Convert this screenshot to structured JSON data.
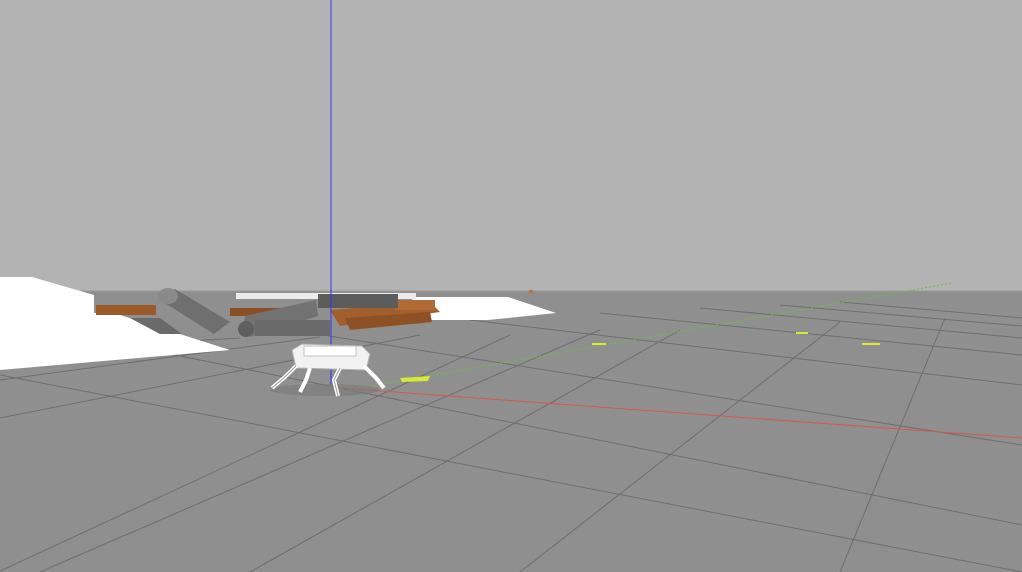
{
  "viewport": {
    "type": "3d-simulation-view",
    "sky_color": "#b3b3b3",
    "ground_color": "#8f8f8f",
    "grid_color": "#6e6e6e"
  },
  "axes": {
    "z_color": "#3030ff",
    "x_color": "#d25a4a",
    "y_color": "#6fbf3a"
  },
  "scene_objects": [
    {
      "name": "quadruped-robot",
      "color": "#ffffff"
    },
    {
      "name": "white-ramp-left-upper",
      "color": "#ffffff"
    },
    {
      "name": "white-ramp-left-lower",
      "color": "#ffffff"
    },
    {
      "name": "white-ramp-center",
      "color": "#ffffff"
    },
    {
      "name": "gray-cylinders",
      "color": "#777777"
    },
    {
      "name": "wooden-logs",
      "color": "#9b5a2a"
    },
    {
      "name": "yellow-markers",
      "color": "#d7e83a"
    }
  ]
}
